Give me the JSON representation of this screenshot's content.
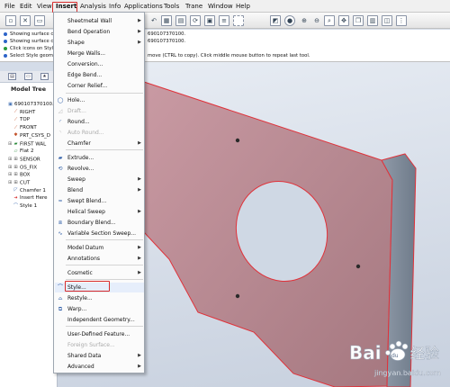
{
  "menubar": {
    "items": [
      "File",
      "Edit",
      "View",
      "Insert",
      "Analysis",
      "Info",
      "Applications",
      "Tools",
      "Trane",
      "Window",
      "Help"
    ]
  },
  "toolbar": {
    "icons": [
      "new-icon",
      "open-icon",
      "close-icon",
      "undo-icon",
      "save-icon",
      "print-icon",
      "regenerate-icon",
      "zoom-in-icon",
      "zoom-out-icon",
      "refit-icon",
      "orient-icon",
      "saved-views-icon",
      "layers-icon"
    ]
  },
  "messages": {
    "lines": [
      "Showing surface c",
      "Showing surface c",
      "Click icons on Style",
      "Select Style geome"
    ],
    "right1": "690107370100.",
    "right2": "690107370100.",
    "right3": "move (CTRL to copy). Click middle mouse button to repeat last tool."
  },
  "model_tree": {
    "title": "Model Tree",
    "items": [
      {
        "label": "690107370100.P",
        "icon": "part-icon"
      },
      {
        "label": "RIGHT",
        "icon": "datum-plane-icon"
      },
      {
        "label": "TOP",
        "icon": "datum-plane-icon"
      },
      {
        "label": "FRONT",
        "icon": "datum-plane-icon"
      },
      {
        "label": "PRT_CSYS_D",
        "icon": "csys-icon"
      },
      {
        "label": "FIRST WAL",
        "icon": "wall-icon"
      },
      {
        "label": "Flat 2",
        "icon": "flat-icon"
      },
      {
        "label": "SENSOR",
        "icon": "group-icon"
      },
      {
        "label": "OS_FIX",
        "icon": "group-icon"
      },
      {
        "label": "BOX",
        "icon": "group-icon"
      },
      {
        "label": "CUT",
        "icon": "group-icon"
      },
      {
        "label": "Chamfer 1",
        "icon": "chamfer-icon"
      },
      {
        "label": "Insert Here",
        "icon": "insert-here-icon"
      },
      {
        "label": "Style 1",
        "icon": "style-feature-icon"
      }
    ]
  },
  "insert_menu": {
    "items": [
      {
        "label": "Sheetmetal Wall",
        "arrow": true,
        "icon": ""
      },
      {
        "label": "Bend Operation",
        "arrow": true,
        "icon": ""
      },
      {
        "label": "Shape",
        "arrow": true,
        "icon": ""
      },
      {
        "label": "Merge Walls...",
        "arrow": false,
        "icon": ""
      },
      {
        "label": "Conversion...",
        "arrow": false,
        "icon": ""
      },
      {
        "label": "Edge Bend...",
        "arrow": false,
        "icon": ""
      },
      {
        "label": "Corner Relief...",
        "arrow": false,
        "icon": ""
      },
      {
        "label": "Hole...",
        "arrow": false,
        "icon": "hole-icon"
      },
      {
        "label": "Draft...",
        "arrow": false,
        "icon": "draft-icon",
        "disabled": true
      },
      {
        "label": "Round...",
        "arrow": false,
        "icon": "round-icon"
      },
      {
        "label": "Auto Round...",
        "arrow": false,
        "icon": "auto-round-icon",
        "disabled": true
      },
      {
        "label": "Chamfer",
        "arrow": true,
        "icon": ""
      },
      {
        "label": "Extrude...",
        "arrow": false,
        "icon": "extrude-icon"
      },
      {
        "label": "Revolve...",
        "arrow": false,
        "icon": "revolve-icon"
      },
      {
        "label": "Sweep",
        "arrow": true,
        "icon": ""
      },
      {
        "label": "Blend",
        "arrow": true,
        "icon": ""
      },
      {
        "label": "Swept Blend...",
        "arrow": false,
        "icon": "swept-blend-icon"
      },
      {
        "label": "Helical Sweep",
        "arrow": true,
        "icon": ""
      },
      {
        "label": "Boundary Blend...",
        "arrow": false,
        "icon": "boundary-blend-icon"
      },
      {
        "label": "Variable Section Sweep...",
        "arrow": false,
        "icon": "variable-section-sweep-icon"
      },
      {
        "label": "Model Datum",
        "arrow": true,
        "icon": ""
      },
      {
        "label": "Annotations",
        "arrow": true,
        "icon": ""
      },
      {
        "label": "Cosmetic",
        "arrow": true,
        "icon": ""
      },
      {
        "label": "Style...",
        "arrow": false,
        "icon": "style-icon",
        "highlighted": true
      },
      {
        "label": "Restyle...",
        "arrow": false,
        "icon": "restyle-icon"
      },
      {
        "label": "Warp...",
        "arrow": false,
        "icon": "warp-icon"
      },
      {
        "label": "Independent Geometry...",
        "arrow": false,
        "icon": ""
      },
      {
        "label": "User-Defined Feature...",
        "arrow": false,
        "icon": ""
      },
      {
        "label": "Foreign Surface...",
        "arrow": false,
        "icon": "",
        "disabled": true
      },
      {
        "label": "Shared Data",
        "arrow": true,
        "icon": ""
      },
      {
        "label": "Advanced",
        "arrow": true,
        "icon": ""
      }
    ]
  },
  "watermark": {
    "brand": "Bai",
    "paw": "du",
    "cn": "经验",
    "url": "jingyan.baidu.com"
  },
  "colors": {
    "highlight": "#d62b2b",
    "part_face": "#b98c95",
    "part_edge": "#e0323a",
    "background": "#d4dce8"
  }
}
